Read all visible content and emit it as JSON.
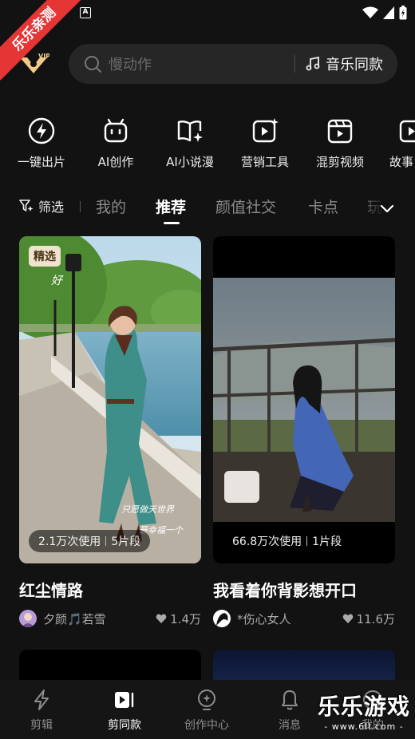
{
  "status_bar": {
    "a_icon": "A"
  },
  "ribbon": {
    "text": "乐乐亲测"
  },
  "header": {
    "logo_text": "VIP",
    "search_placeholder": "慢动作",
    "music_label": "音乐同款"
  },
  "tools": [
    {
      "label": "一键出片",
      "icon": "lightning-icon"
    },
    {
      "label": "AI创作",
      "icon": "robot-icon"
    },
    {
      "label": "AI小说漫",
      "icon": "book-icon"
    },
    {
      "label": "营销工具",
      "icon": "play-sparkle-icon"
    },
    {
      "label": "混剪视频",
      "icon": "clapper-icon"
    },
    {
      "label": "故事",
      "icon": "play-icon"
    }
  ],
  "tabs": {
    "filter_label": "筛选",
    "items": [
      "我的",
      "推荐",
      "颜值社交",
      "卡点",
      "玩"
    ],
    "active": "推荐"
  },
  "cards": [
    {
      "badge": "精选",
      "uses": "2.1万次使用",
      "segments": "5片段",
      "title": "红尘情路",
      "author": "夕颜🎵若雪",
      "likes": "1.4万",
      "overlay_text_1": "好",
      "overlay_text_2": "只愿做天世界",
      "overlay_text_3": "最幸福一个"
    },
    {
      "uses": "66.8万次使用",
      "segments": "1片段",
      "title": "我看着你背影想开口",
      "author": "*伤心女人",
      "likes": "11.6万"
    }
  ],
  "bottom_nav": [
    {
      "label": "剪辑",
      "icon": "lightning-outline-icon"
    },
    {
      "label": "剪同款",
      "icon": "video-template-icon"
    },
    {
      "label": "创作中心",
      "icon": "bulb-icon"
    },
    {
      "label": "消息",
      "icon": "bell-icon"
    },
    {
      "label": "我的",
      "icon": "smile-icon"
    }
  ],
  "nav_active": "剪同款",
  "watermark": {
    "title": "乐乐游戏",
    "url": "- www.6ll.com -"
  },
  "colors": {
    "background": "#121212",
    "ribbon": "#e53535",
    "badge": "#efe3cf"
  }
}
